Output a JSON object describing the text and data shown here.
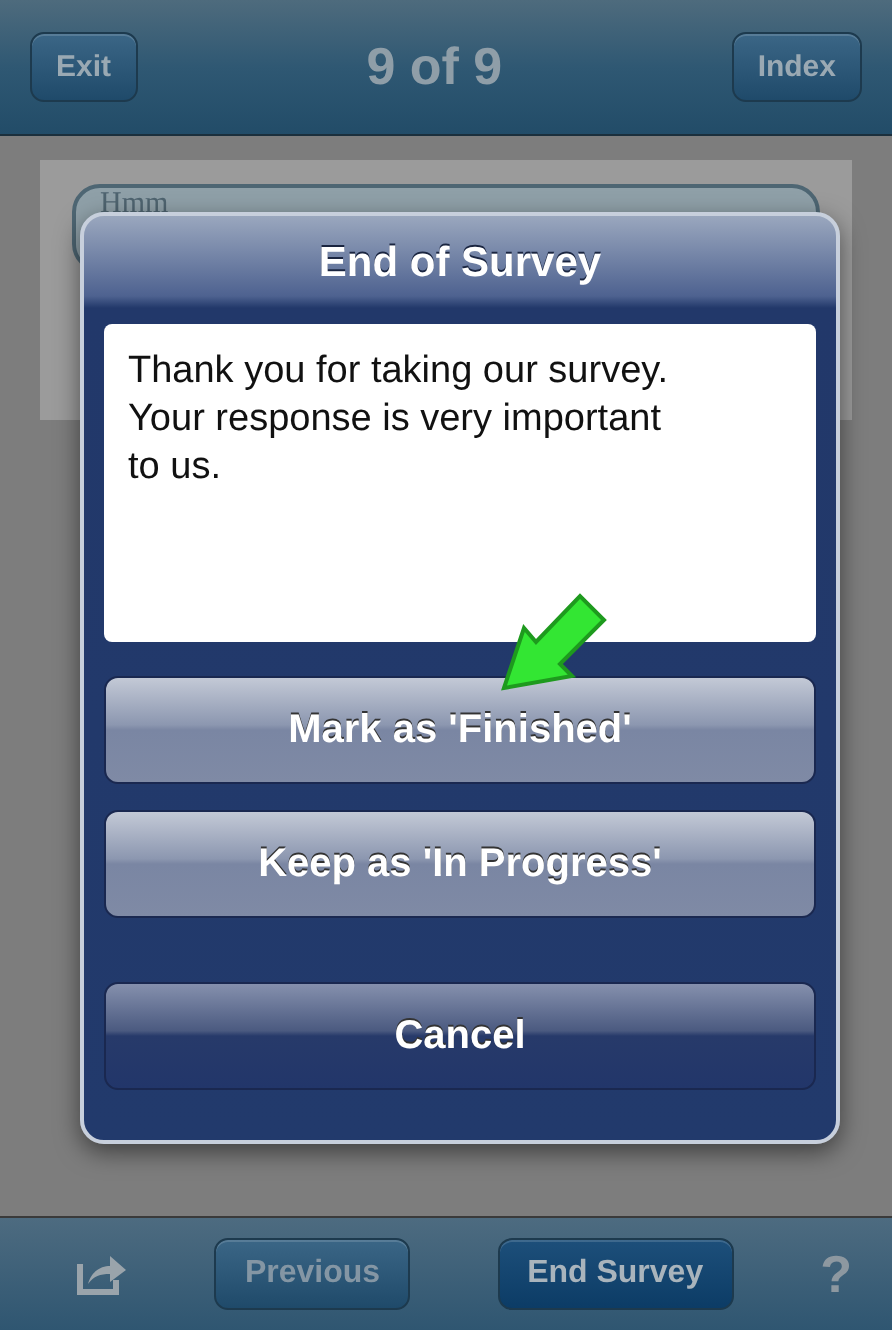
{
  "nav_bar": {
    "title": "9 of 9",
    "left_button": "Exit",
    "right_button": "Index"
  },
  "background_card": {
    "bubble_text": "Hmm"
  },
  "dialog": {
    "title": "End of Survey",
    "message": "Thank you for taking our survey. Your response is very important to us.",
    "buttons": [
      {
        "label": "Mark as 'Finished'",
        "kind": "option"
      },
      {
        "label": "Keep as 'In Progress'",
        "kind": "option"
      },
      {
        "label": "Cancel",
        "kind": "cancel"
      }
    ]
  },
  "toolbar": {
    "buttons": [
      {
        "label": "Previous",
        "highlighted": false
      },
      {
        "label": "End Survey",
        "highlighted": true
      }
    ],
    "help": "?"
  }
}
